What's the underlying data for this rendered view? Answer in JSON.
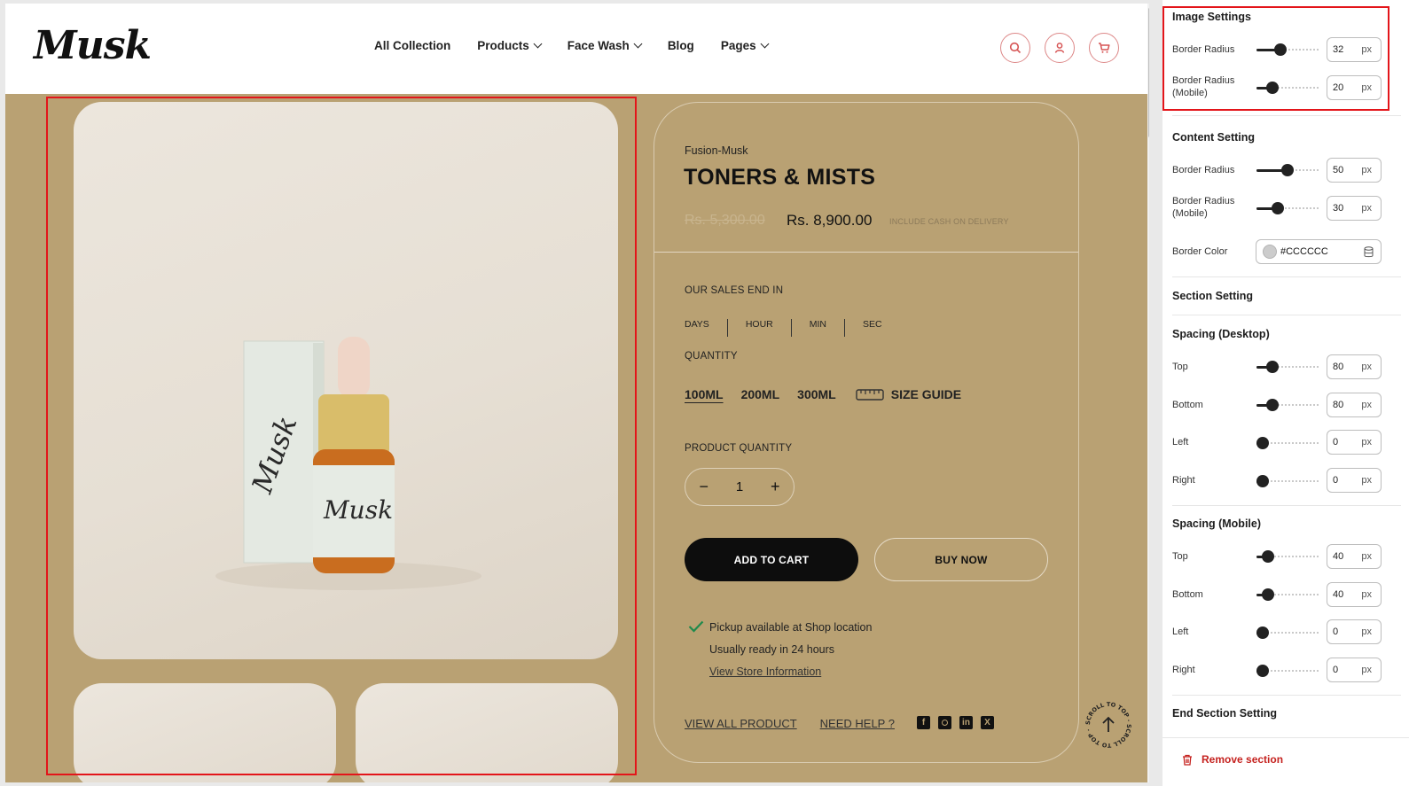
{
  "store": {
    "logo": "Musk",
    "nav": [
      {
        "label": "All Collection",
        "has_dropdown": false
      },
      {
        "label": "Products",
        "has_dropdown": true
      },
      {
        "label": "Face Wash",
        "has_dropdown": true
      },
      {
        "label": "Blog",
        "has_dropdown": false
      },
      {
        "label": "Pages",
        "has_dropdown": true
      }
    ],
    "header_icons": [
      "search-icon",
      "user-icon",
      "cart-icon"
    ],
    "accent_color": "#d65454",
    "background_color": "#b9a173"
  },
  "product": {
    "vendor": "Fusion-Musk",
    "title": "TONERS & MISTS",
    "compare_price": "Rs. 5,300.00",
    "price": "Rs. 8,900.00",
    "price_note": "INCLUDE CASH ON DELIVERY",
    "sales_end_label": "OUR SALES END IN",
    "timer_units": [
      "DAYS",
      "HOUR",
      "MIN",
      "SEC"
    ],
    "quantity_label": "QUANTITY",
    "variants": [
      "100ML",
      "200ML",
      "300ML"
    ],
    "selected_variant": "100ML",
    "size_guide": "SIZE GUIDE",
    "product_quantity_label": "PRODUCT QUANTITY",
    "qty_minus": "−",
    "qty_value": "1",
    "qty_plus": "+",
    "add_to_cart": "ADD TO CART",
    "buy_now": "BUY NOW",
    "pickup_text": "Pickup available at Shop location",
    "ready_text": "Usually ready in 24 hours",
    "store_info_link": "View Store Information",
    "view_all_link": "VIEW ALL PRODUCT",
    "need_help_link": "NEED HELP ?",
    "socials": [
      "facebook-icon",
      "instagram-icon",
      "linkedin-icon",
      "x-icon"
    ],
    "scroll_top_text": "SCROLL TO TOP · SCROLL TO TOP ·"
  },
  "panel": {
    "image_settings": {
      "title": "Image Settings",
      "rows": [
        {
          "label": "Border Radius",
          "value": "32",
          "unit": "px",
          "level": 0.35
        },
        {
          "label": "Border Radius (Mobile)",
          "value": "20",
          "unit": "px",
          "level": 0.2
        }
      ]
    },
    "content_setting": {
      "title": "Content Setting",
      "rows": [
        {
          "label": "Border Radius",
          "value": "50",
          "unit": "px",
          "level": 0.5
        },
        {
          "label": "Border Radius (Mobile)",
          "value": "30",
          "unit": "px",
          "level": 0.3
        }
      ],
      "border_color_label": "Border Color",
      "border_color_value": "#CCCCCC"
    },
    "section_setting_title": "Section Setting",
    "spacing_desktop": {
      "title": "Spacing (Desktop)",
      "rows": [
        {
          "label": "Top",
          "value": "80",
          "unit": "px",
          "level": 0.2
        },
        {
          "label": "Bottom",
          "value": "80",
          "unit": "px",
          "level": 0.2
        },
        {
          "label": "Left",
          "value": "0",
          "unit": "px",
          "level": 0
        },
        {
          "label": "Right",
          "value": "0",
          "unit": "px",
          "level": 0
        }
      ]
    },
    "spacing_mobile": {
      "title": "Spacing (Mobile)",
      "rows": [
        {
          "label": "Top",
          "value": "40",
          "unit": "px",
          "level": 0.1
        },
        {
          "label": "Bottom",
          "value": "40",
          "unit": "px",
          "level": 0.1
        },
        {
          "label": "Left",
          "value": "0",
          "unit": "px",
          "level": 0
        },
        {
          "label": "Right",
          "value": "0",
          "unit": "px",
          "level": 0
        }
      ]
    },
    "end_section_title": "End Section Setting",
    "remove_section": "Remove section"
  }
}
